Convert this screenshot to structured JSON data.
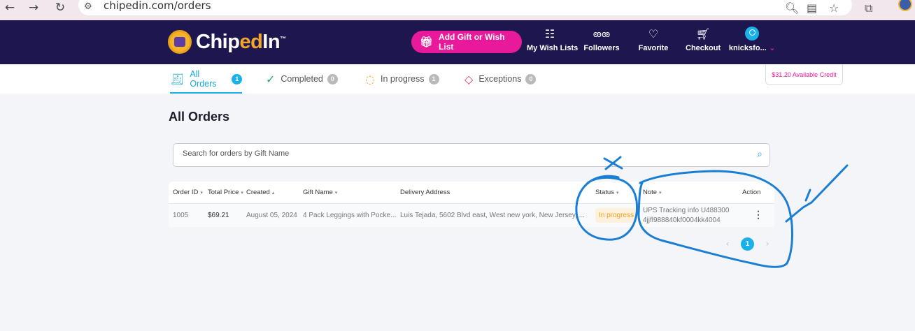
{
  "browser": {
    "url": "chipedin.com/orders",
    "back_icon": "arrow-left-icon",
    "forward_icon": "arrow-right-icon",
    "reload_icon": "reload-icon"
  },
  "header": {
    "logo": {
      "part1": "Chip",
      "part2": "ed",
      "part3": "In",
      "tm": "™"
    },
    "add_gift_label": "Add Gift or Wish List",
    "nav": {
      "wish_lists": "My Wish Lists",
      "followers": "Followers",
      "favorite": "Favorite",
      "checkout": "Checkout",
      "account": "knicksfo..."
    }
  },
  "tabs": [
    {
      "label": "All Orders",
      "count": "1"
    },
    {
      "label": "Completed",
      "count": "0"
    },
    {
      "label": "In progress",
      "count": "1"
    },
    {
      "label": "Exceptions",
      "count": "0"
    }
  ],
  "credit": "$31.20 Available Credit",
  "main": {
    "title": "All Orders",
    "search_placeholder": "Search for orders by Gift Name"
  },
  "table": {
    "headers": {
      "order_id": "Order ID",
      "total_price": "Total Price",
      "created": "Created",
      "gift_name": "Gift Name",
      "delivery_address": "Delivery Address",
      "status": "Status",
      "note": "Note",
      "action": "Action"
    },
    "rows": [
      {
        "order_id": "1005",
        "total_price": "$69.21",
        "created": "August 05, 2024",
        "gift_name": "4 Pack Leggings with Pocke...",
        "delivery_address": "Luis Tejada, 5602 Blvd east, West new york, New Jersey, ...",
        "status": "In progress",
        "note": "UPS Tracking info U488300 4jjfl988840kf0004kk4004"
      }
    ]
  },
  "pagination": {
    "current": "1"
  },
  "colors": {
    "header_bg": "#1d164f",
    "accent": "#1ab0e8",
    "brand_pink": "#e8199b",
    "status_in_progress": "#f0a020",
    "annotation_ink": "#1a7fd4"
  }
}
